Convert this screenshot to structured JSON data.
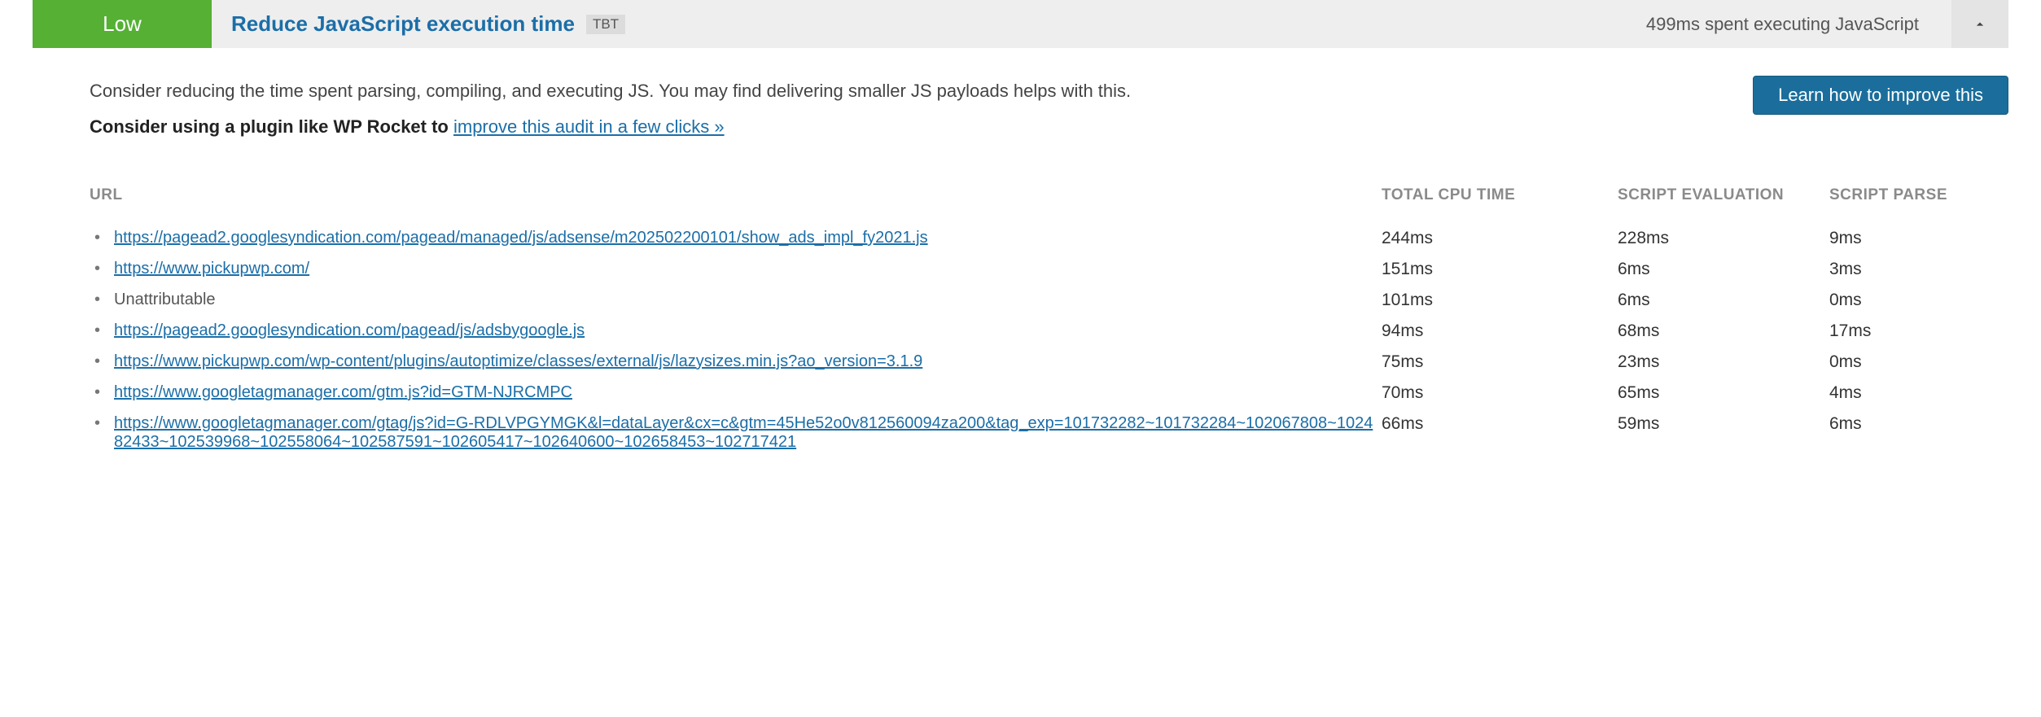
{
  "header": {
    "severity": "Low",
    "title": "Reduce JavaScript execution time",
    "metric_badge": "TBT",
    "summary": "499ms spent executing JavaScript"
  },
  "body": {
    "description": "Consider reducing the time spent parsing, compiling, and executing JS. You may find delivering smaller JS payloads helps with this.",
    "plugin_prefix": "Consider using a plugin like WP Rocket to ",
    "plugin_link_text": "improve this audit in a few clicks »",
    "learn_button": "Learn how to improve this"
  },
  "table": {
    "headers": {
      "url": "URL",
      "cpu": "TOTAL CPU TIME",
      "eval": "SCRIPT EVALUATION",
      "parse": "SCRIPT PARSE"
    },
    "rows": [
      {
        "url": "https://pagead2.googlesyndication.com/pagead/managed/js/adsense/m202502200101/show_ads_impl_fy2021.js",
        "is_link": true,
        "cpu": "244ms",
        "eval": "228ms",
        "parse": "9ms"
      },
      {
        "url": "https://www.pickupwp.com/",
        "is_link": true,
        "cpu": "151ms",
        "eval": "6ms",
        "parse": "3ms"
      },
      {
        "url": "Unattributable",
        "is_link": false,
        "cpu": "101ms",
        "eval": "6ms",
        "parse": "0ms"
      },
      {
        "url": "https://pagead2.googlesyndication.com/pagead/js/adsbygoogle.js",
        "is_link": true,
        "cpu": "94ms",
        "eval": "68ms",
        "parse": "17ms"
      },
      {
        "url": "https://www.pickupwp.com/wp-content/plugins/autoptimize/classes/external/js/lazysizes.min.js?ao_version=3.1.9",
        "is_link": true,
        "cpu": "75ms",
        "eval": "23ms",
        "parse": "0ms"
      },
      {
        "url": "https://www.googletagmanager.com/gtm.js?id=GTM-NJRCMPC",
        "is_link": true,
        "cpu": "70ms",
        "eval": "65ms",
        "parse": "4ms"
      },
      {
        "url": "https://www.googletagmanager.com/gtag/js?id=G-RDLVPGYMGK&l=dataLayer&cx=c&gtm=45He52o0v812560094za200&tag_exp=101732282~101732284~102067808~102482433~102539968~102558064~102587591~102605417~102640600~102658453~102717421",
        "is_link": true,
        "cpu": "66ms",
        "eval": "59ms",
        "parse": "6ms"
      }
    ]
  }
}
